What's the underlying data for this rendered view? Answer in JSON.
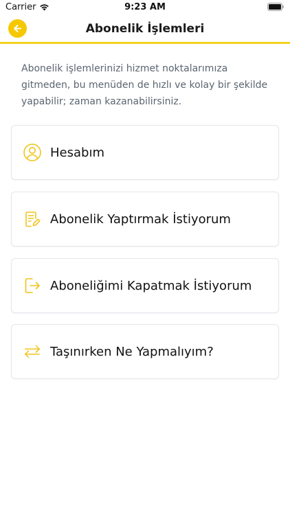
{
  "status_bar": {
    "carrier": "Carrier",
    "time": "9:23 AM"
  },
  "header": {
    "title": "Abonelik İşlemleri"
  },
  "intro_text": "Abonelik işlemlerinizi hizmet noktalarımıza gitmeden, bu menüden de hızlı ve kolay bir şekilde yapabilir; zaman kazanabilirsiniz.",
  "menu": {
    "items": [
      {
        "label": "Hesabım",
        "icon": "user-circle-icon"
      },
      {
        "label": "Abonelik Yaptırmak İstiyorum",
        "icon": "document-edit-icon"
      },
      {
        "label": "Aboneliğimi Kapatmak İstiyorum",
        "icon": "logout-icon"
      },
      {
        "label": "Taşınırken Ne Yapmalıyım?",
        "icon": "transfer-arrows-icon"
      }
    ]
  },
  "colors": {
    "accent": "#f5c800",
    "icon": "#f0c419",
    "divider": "#f5d21f"
  }
}
